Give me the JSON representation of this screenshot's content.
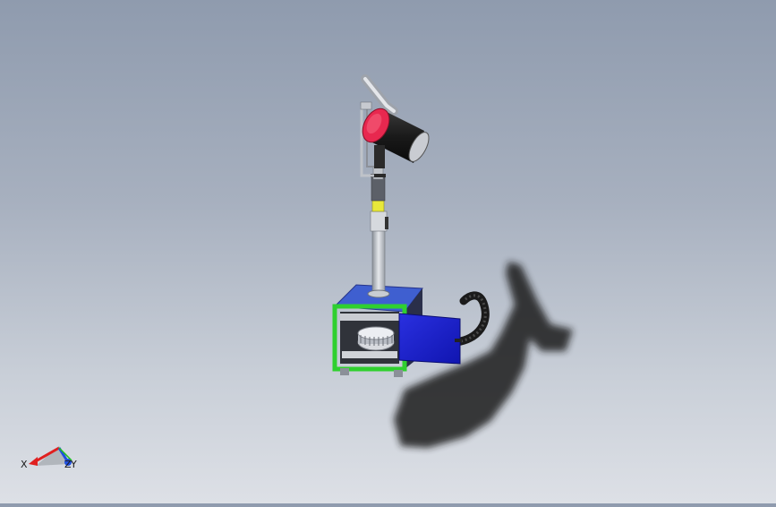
{
  "viewport": {
    "background_top": "#8f9bae",
    "background_bottom": "#dde0e6"
  },
  "model": {
    "base_top_color": "#3f5fd0",
    "frame_color": "#2fd02f",
    "door_color": "#1a1fc8",
    "motor_cap_color": "#e8284f",
    "sleeve_color": "#e8e83a",
    "shadow_color": "#1e1e1e"
  },
  "triad": {
    "x_label": "X",
    "y_label": "Y",
    "z_label": "Z",
    "x_color": "#e02020",
    "y_color": "#20c020",
    "z_color": "#2050e0"
  }
}
